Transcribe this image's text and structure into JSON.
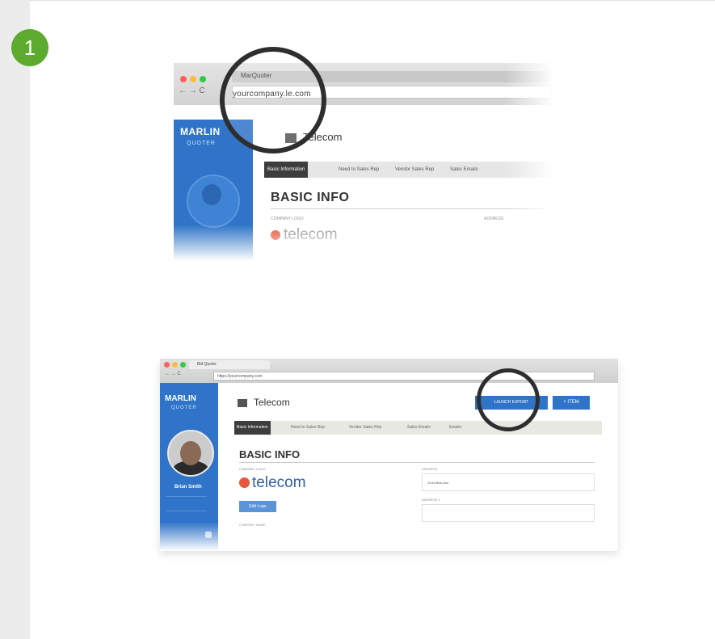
{
  "step": {
    "number": "1"
  },
  "shot1": {
    "tab_title": "MarQuoter",
    "url": "yourcompany.le.com",
    "nav": "← → C",
    "logo": "MARLIN",
    "sublogo": "QUOTER",
    "company": "Telecom",
    "tabs": [
      "Basic Information",
      "Need to Sales Rep",
      "Vendor Sales Rep",
      "Sales Emails"
    ],
    "heading": "BASIC INFO",
    "label_logo": "COMPANY LOGO",
    "label_address": "ADDRESS",
    "telecom_logo": "telecom"
  },
  "shot2": {
    "tab_title": "Bid Quoter",
    "url": "https://yourcompany.com",
    "nav": "← → C",
    "logo": "MARLIN",
    "sublogo": "QUOTER",
    "user_name": "Brian Smith",
    "company": "Telecom",
    "button_primary": "LAUNCH EXPORT",
    "button_secondary": "+ ITEM",
    "tabs": [
      "Basic Information",
      "Need to Sales Rep",
      "Vendor Sales Rep",
      "Sales Emails",
      "Emails"
    ],
    "heading": "BASIC INFO",
    "label_logo": "COMPANY LOGO",
    "label_address": "ADDRESS",
    "label_address2": "ADDRESS 2",
    "label_company_name": "COMPANY NAME",
    "telecom_logo": "telecom",
    "edit_button": "Edit Logo",
    "address_value": "1234 Main Ave"
  },
  "colors": {
    "accent": "#2f74c8",
    "badge": "#5cab2e",
    "telecom_dot": "#e7573b"
  }
}
